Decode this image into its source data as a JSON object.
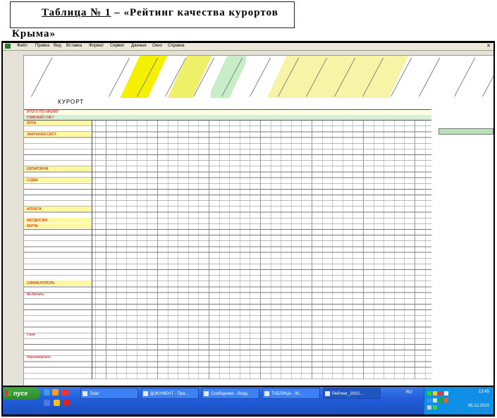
{
  "caption": {
    "prefix": "Таблица № 1",
    "suffix": " – «Рейтинг качества курортов",
    "line2": "Крыма»"
  },
  "excel": {
    "menu": [
      "Файл",
      "Правка",
      "Вид",
      "Вставка",
      "Формат",
      "Сервис",
      "Данные",
      "Окно",
      "Справка"
    ],
    "sheet_title": "КУРОРТ",
    "header_label": "ИТОГО ПО КРЫМУ",
    "row_labels_visible": [
      "ГЛАВНЫЙ СЧЕТ",
      "ЯЛТА",
      "ЗАКРЫТАЯ СИСТ",
      "ЕВПАТОРИЯ",
      "СУДАК",
      "АЛУШТА",
      "ФЕОДОСИЯ",
      "КЕРЧЬ",
      "СИМФЕРОПОЛЬ",
      "Ак-Мечеть",
      "Саки",
      "Черноморское"
    ]
  },
  "taskbar": {
    "start_label": "пуск",
    "items": [
      "Total",
      "ДОКУМЕНТ - Пра...",
      "Сообщение - Ворд",
      "ТАБЛИЦА - W...",
      "Рейтинг_2010..."
    ],
    "lang": "RU",
    "clock": "13:45",
    "date": "05.12.2010"
  }
}
